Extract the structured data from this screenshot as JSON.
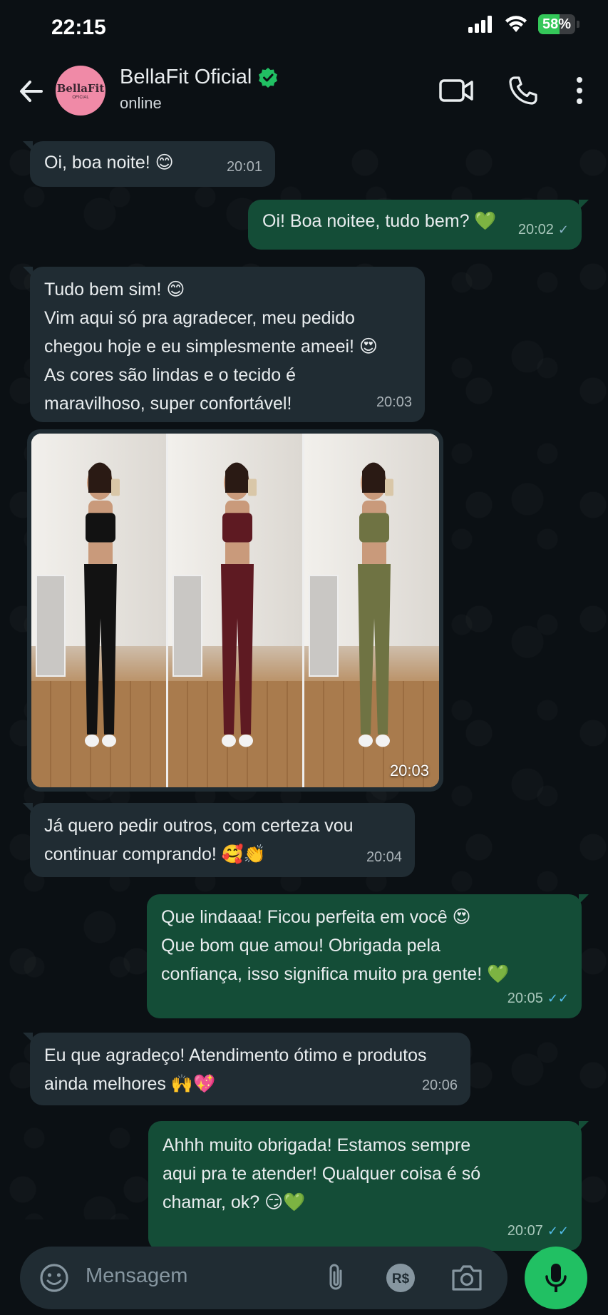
{
  "status_bar": {
    "time": "22:15",
    "battery": "58%",
    "battery_level": 0.58
  },
  "header": {
    "contact_name": "BellaFit Oficial",
    "contact_status": "online",
    "avatar_text": "BellaFit",
    "avatar_subtext": "OFICIAL"
  },
  "messages": [
    {
      "dir": "in",
      "text": "Oi, boa noite! 😊",
      "time": "20:01"
    },
    {
      "dir": "out",
      "text": "Oi! Boa noitee, tudo bem? 💚",
      "time": "20:02",
      "status": "sent"
    },
    {
      "dir": "in",
      "lines": [
        "Tudo bem sim! 😊",
        "Vim aqui só pra agradecer, meu pedido",
        "chegou hoje e eu simplesmente ameei! 😍",
        "As cores são lindas e o tecido é",
        "maravilhoso, super confortável!"
      ],
      "time": "20:03"
    },
    {
      "dir": "in",
      "type": "image",
      "time": "20:03",
      "outfit_colors": [
        "#121212",
        "#5e1a22",
        "#6f7343"
      ]
    },
    {
      "dir": "in",
      "lines": [
        "Já quero pedir outros, com certeza vou",
        "continuar comprando! 🥰👏"
      ],
      "time": "20:04"
    },
    {
      "dir": "out",
      "lines": [
        "Que lindaaa! Ficou perfeita em você 😍",
        "Que bom que amou! Obrigada pela",
        "confiança, isso significa muito pra gente! 💚"
      ],
      "time": "20:05",
      "status": "read"
    },
    {
      "dir": "in",
      "lines": [
        "Eu que agradeço! Atendimento ótimo e produtos",
        "ainda melhores 🙌💖"
      ],
      "time": "20:06"
    },
    {
      "dir": "out",
      "lines": [
        "Ahhh muito obrigada! Estamos sempre",
        "aqui pra te atender! Qualquer coisa é só",
        "chamar, ok? 😏💚"
      ],
      "time": "20:07",
      "status": "read"
    }
  ],
  "input": {
    "placeholder": "Mensagem",
    "pay_label": "R$"
  },
  "colors": {
    "incoming": "#202c33",
    "outgoing": "#144d37",
    "accent": "#21c063",
    "read_tick": "#53bdeb"
  }
}
